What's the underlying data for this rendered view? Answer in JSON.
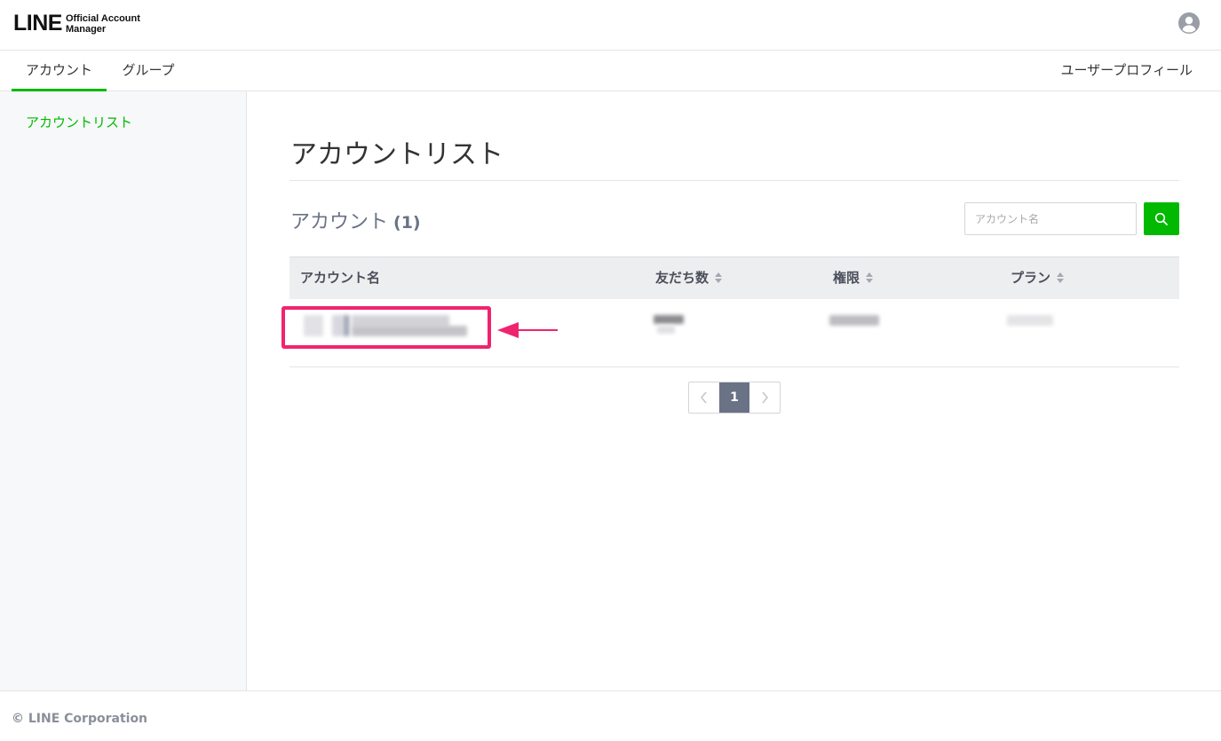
{
  "header": {
    "logo_main": "LINE",
    "logo_sub_line1": "Official Account",
    "logo_sub_line2": "Manager"
  },
  "nav": {
    "tabs": [
      {
        "label": "アカウント",
        "active": true
      },
      {
        "label": "グループ",
        "active": false
      }
    ],
    "profile_label": "ユーザープロフィール"
  },
  "sidebar": {
    "items": [
      {
        "label": "アカウントリスト",
        "active": true
      }
    ]
  },
  "main": {
    "page_title": "アカウントリスト",
    "section_title": "アカウント",
    "section_count": "(1)",
    "search": {
      "placeholder": "アカウント名"
    },
    "table": {
      "columns": [
        "アカウント名",
        "友だち数",
        "権限",
        "プラン"
      ],
      "sortable": [
        false,
        true,
        true,
        true
      ]
    },
    "pagination": {
      "current_page": "1",
      "prev": "‹",
      "next": "›"
    }
  },
  "footer": {
    "copyright": "© LINE Corporation"
  },
  "colors": {
    "brand_green": "#00b900",
    "highlight_pink": "#f0246e",
    "heading_slate": "#6a7286"
  }
}
